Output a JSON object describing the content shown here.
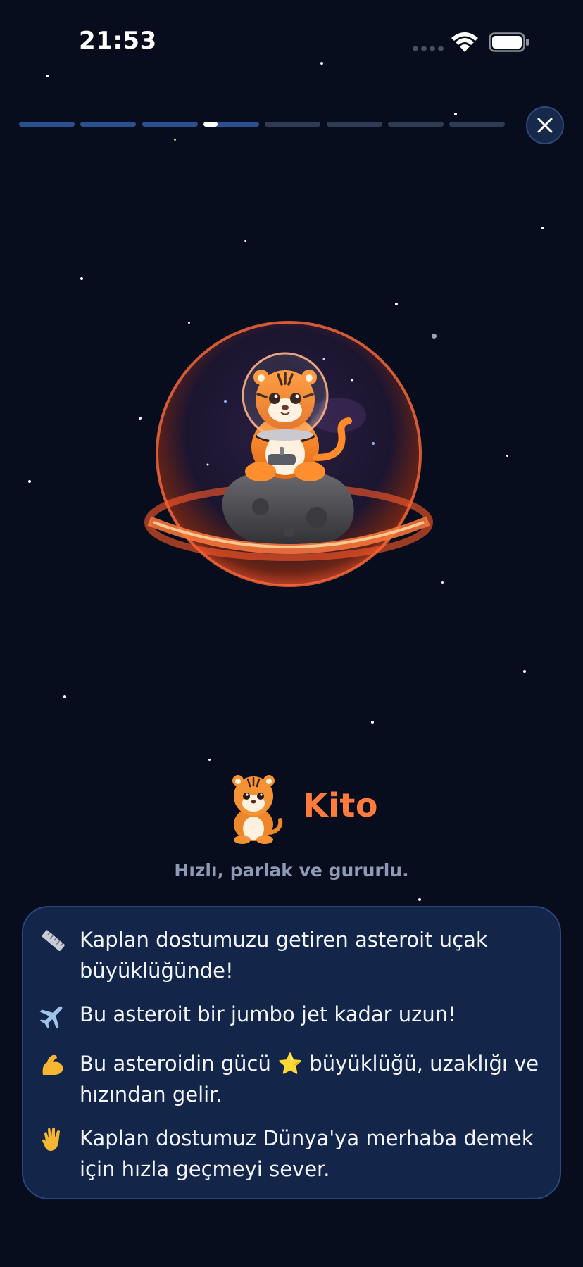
{
  "status_bar": {
    "time": "21:53"
  },
  "progress": {
    "segment_count": 8,
    "segments": [
      1,
      1,
      1,
      0.25,
      0,
      0,
      0,
      0
    ]
  },
  "close_icon": "close-icon",
  "character": {
    "name": "Kito",
    "tagline": "Hızlı, parlak ve gururlu."
  },
  "facts": [
    {
      "icon": "ruler-icon",
      "text": "Kaplan dostumuzu getiren asteroit uçak büyüklüğünde!"
    },
    {
      "icon": "airplane-icon",
      "text": "Bu asteroit bir jumbo jet kadar uzun!"
    },
    {
      "icon": "flexed-biceps-icon",
      "text": "Bu asteroidin gücü ⭐ büyüklüğü, uzaklığı ve hızından gelir."
    },
    {
      "icon": "waving-hand-icon",
      "text": "Kaplan dostumuz Dünya'ya merhaba demek için hızla geçmeyi sever."
    }
  ],
  "colors": {
    "background": "#070d1c",
    "accent_name": "#ff7a3d",
    "card_background": "#14254a",
    "card_border": "#29477d",
    "progress_track": "#2f3a55",
    "progress_done": "#2c4f8e"
  }
}
